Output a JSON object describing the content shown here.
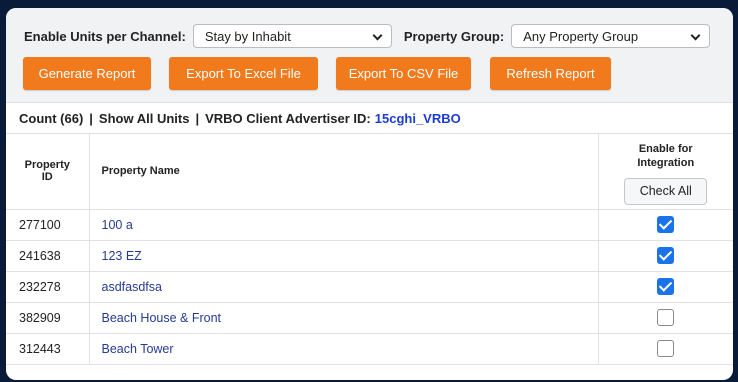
{
  "toolbar": {
    "units_label": "Enable Units per Channel:",
    "units_value": "Stay by Inhabit",
    "group_label": "Property Group:",
    "group_value": "Any Property Group",
    "buttons": {
      "generate": "Generate Report",
      "excel": "Export To Excel File",
      "csv": "Export To CSV File",
      "refresh": "Refresh Report"
    }
  },
  "summary": {
    "count": "Count (66)",
    "sep": "|",
    "show_all": "Show All Units",
    "advertiser_label": "VRBO Client Advertiser ID:",
    "advertiser_id": "15cghi_VRBO"
  },
  "table": {
    "headers": {
      "id": "Property ID",
      "name": "Property Name",
      "integration": "Enable for Integration",
      "check_all": "Check All"
    },
    "rows": [
      {
        "id": "277100",
        "name": "100 a",
        "checked": true
      },
      {
        "id": "241638",
        "name": "123 EZ",
        "checked": true
      },
      {
        "id": "232278",
        "name": "asdfasdfsa",
        "checked": true
      },
      {
        "id": "382909",
        "name": "Beach House & Front",
        "checked": false
      },
      {
        "id": "312443",
        "name": "Beach Tower",
        "checked": false
      }
    ]
  },
  "colors": {
    "accent_orange": "#f17a1c",
    "checkbox_blue": "#1a73e8",
    "link_blue": "#253c8f",
    "advertiser_blue": "#1d3cd6",
    "background": "#0a1b3a"
  }
}
